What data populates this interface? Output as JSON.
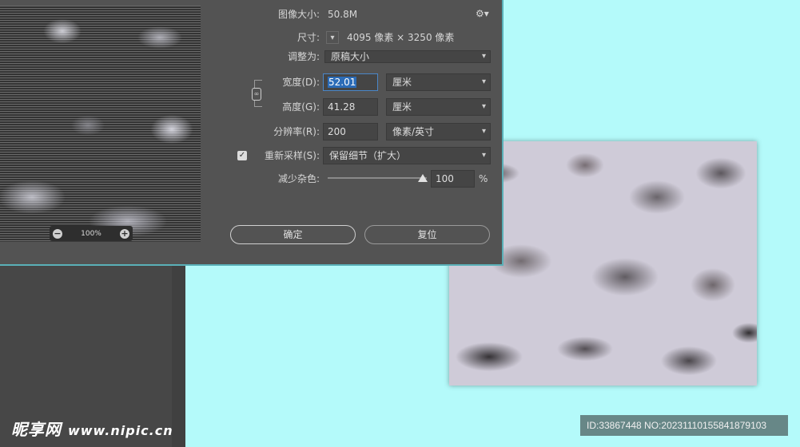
{
  "dialog": {
    "image_size_label": "图像大小:",
    "image_size_value": "50.8M",
    "dimensions_label": "尺寸:",
    "dimensions_value": "4095 像素 × 3250 像素",
    "fit_to_label": "调整为:",
    "fit_to_value": "原稿大小",
    "width_label": "宽度(D):",
    "width_value": "52.01",
    "width_unit": "厘米",
    "height_label": "高度(G):",
    "height_value": "41.28",
    "height_unit": "厘米",
    "resolution_label": "分辨率(R):",
    "resolution_value": "200",
    "resolution_unit": "像素/英寸",
    "resample_label": "重新采样(S):",
    "resample_checked": true,
    "resample_value": "保留细节（扩大）",
    "noise_label": "减少杂色:",
    "noise_value": "100",
    "noise_unit": "%",
    "noise_level_percent": 100,
    "ok_label": "确定",
    "reset_label": "复位"
  },
  "preview": {
    "zoom": "100%",
    "zoom_out_icon": "minus-circle-icon",
    "zoom_in_icon": "plus-circle-icon"
  },
  "watermark": {
    "site_name": "昵享网",
    "site_url": "www.nipic.cn",
    "id_text": "ID:33867448 NO:20231110155841879103"
  },
  "colors": {
    "canvas_bg": "#b4fafa",
    "dialog_bg": "#535353",
    "selection": "#2b6cb8"
  }
}
